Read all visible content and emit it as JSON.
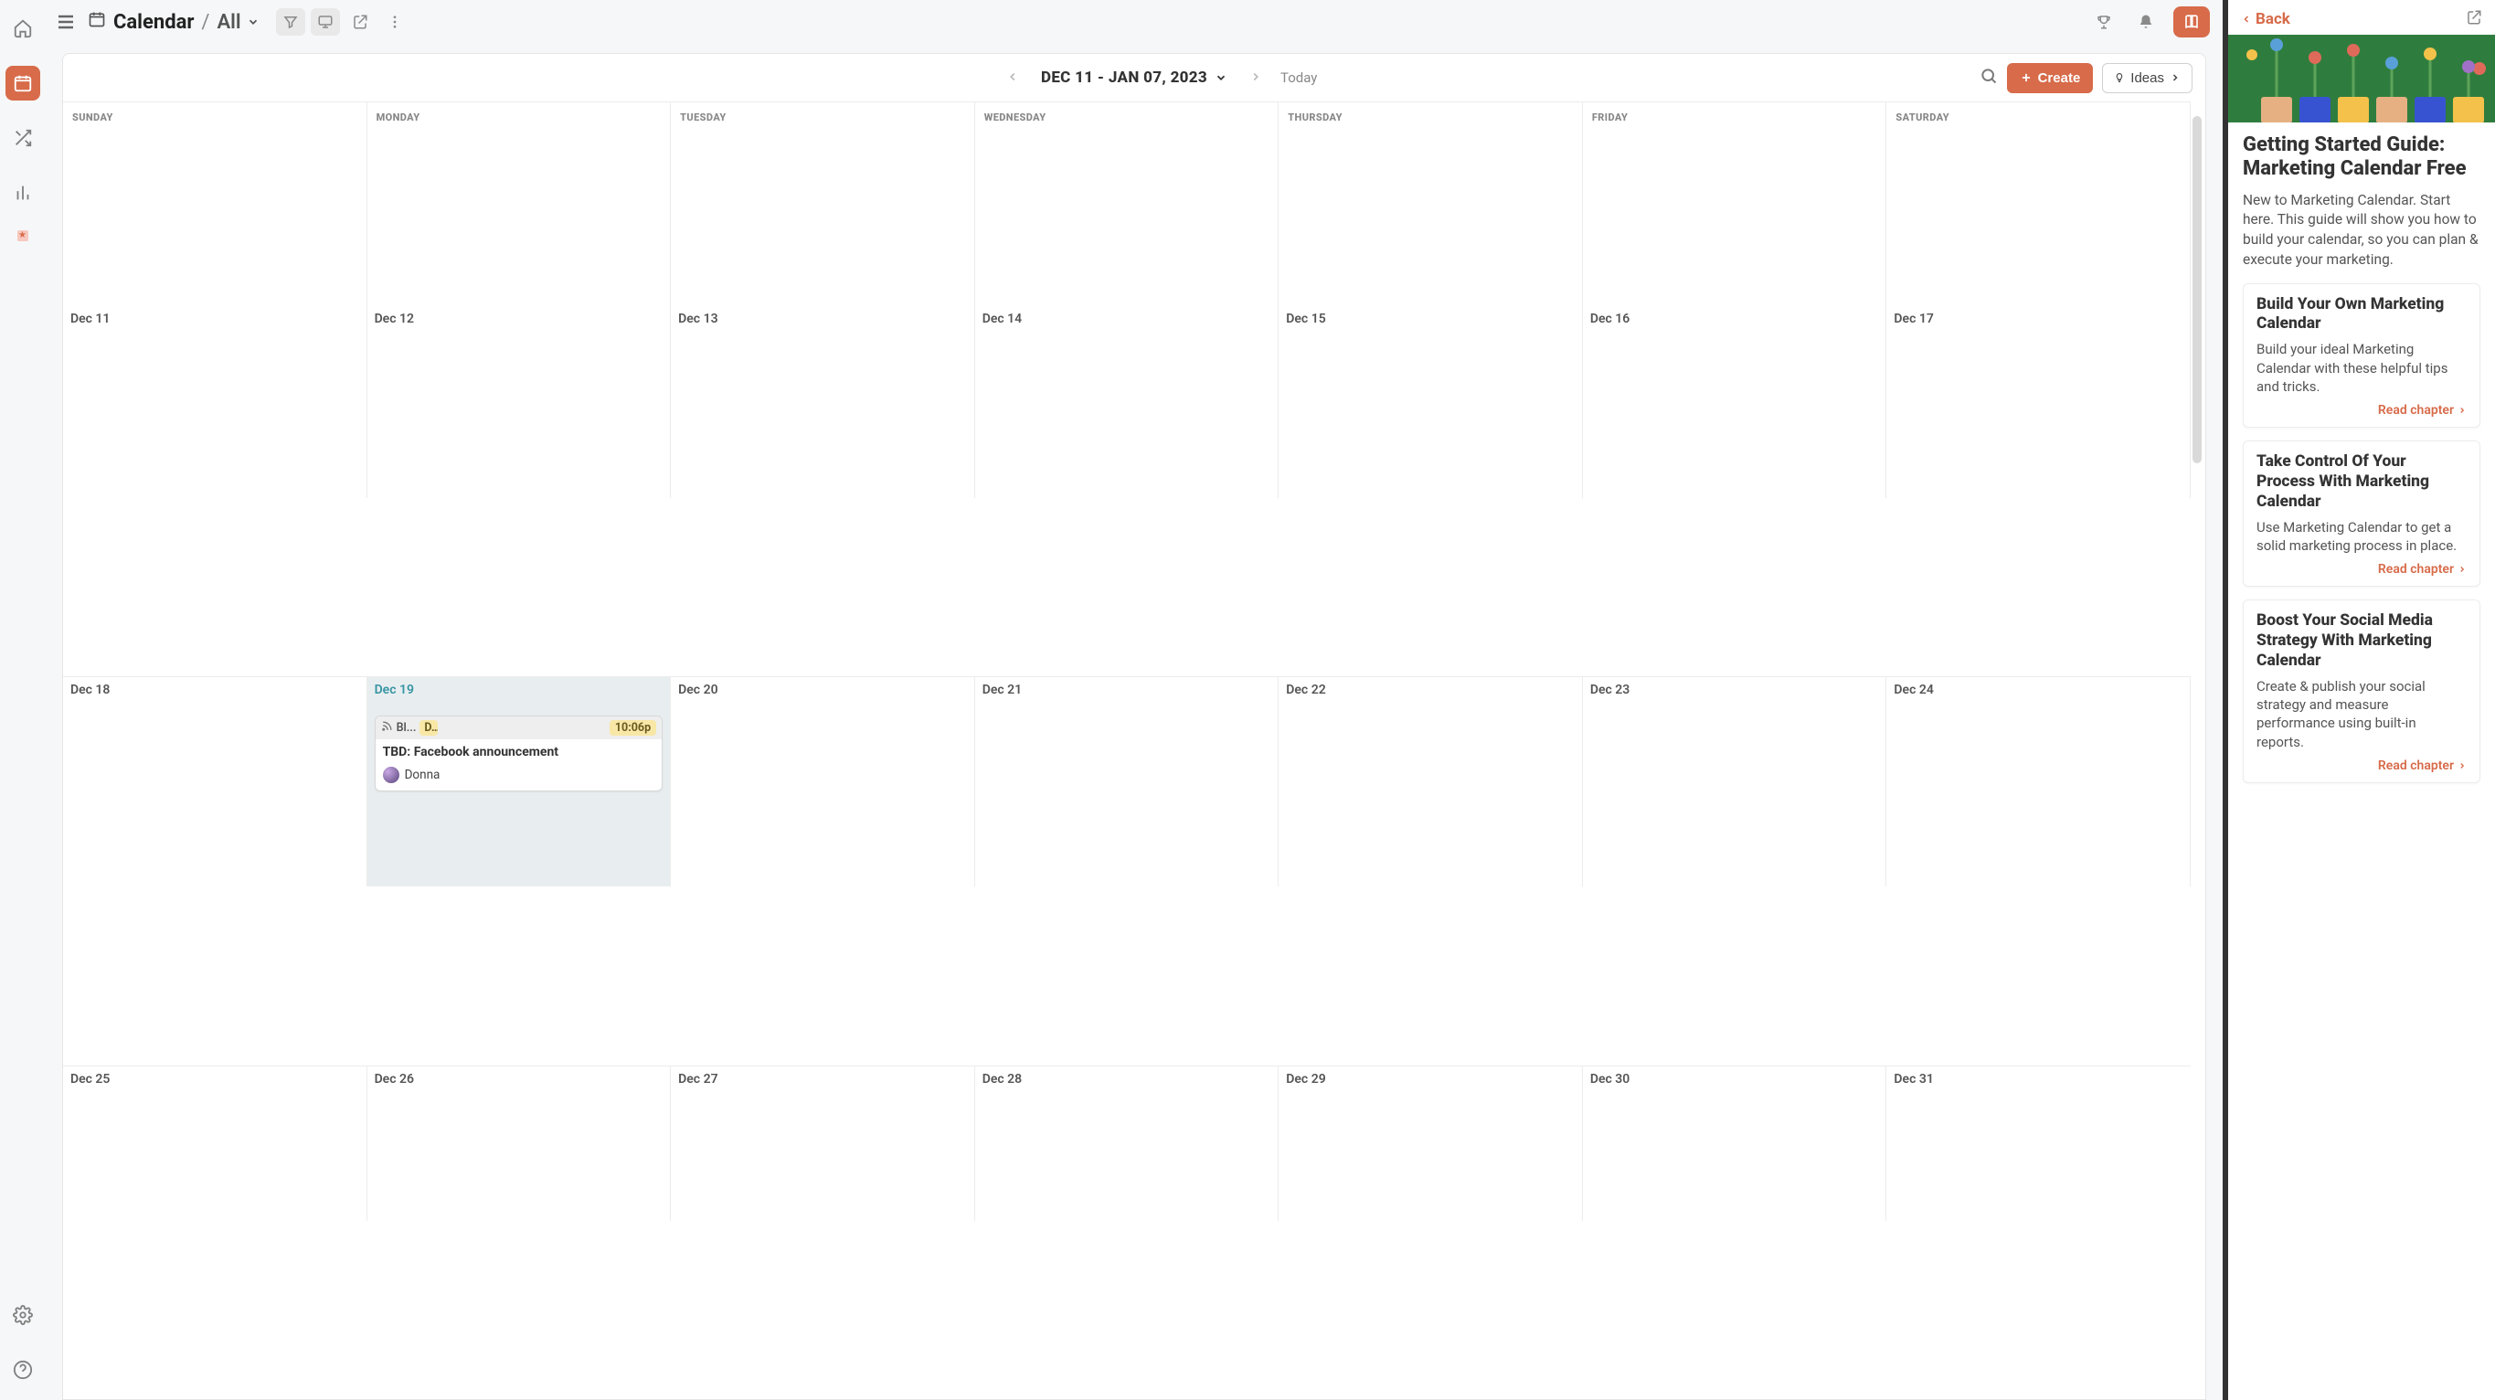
{
  "header": {
    "title": "Calendar",
    "view": "All"
  },
  "calendar": {
    "range_label": "DEC 11 - JAN 07, 2023",
    "today_label": "Today",
    "create_label": "Create",
    "ideas_label": "Ideas",
    "dow": [
      "SUNDAY",
      "MONDAY",
      "TUESDAY",
      "WEDNESDAY",
      "THURSDAY",
      "FRIDAY",
      "SATURDAY"
    ],
    "weeks": [
      [
        "Dec 11",
        "Dec 12",
        "Dec 13",
        "Dec 14",
        "Dec 15",
        "Dec 16",
        "Dec 17"
      ],
      [
        "Dec 18",
        "Dec 19",
        "Dec 20",
        "Dec 21",
        "Dec 22",
        "Dec 23",
        "Dec 24"
      ],
      [
        "Dec 25",
        "Dec 26",
        "Dec 27",
        "Dec 28",
        "Dec 29",
        "Dec 30",
        "Dec 31"
      ]
    ],
    "today_index": {
      "week": 1,
      "day": 1
    }
  },
  "event": {
    "tag_short": "Bl...",
    "status_short": "D...",
    "time": "10:06p",
    "title": "TBD: Facebook announcement",
    "assignee": "Donna"
  },
  "guide": {
    "back_label": "Back",
    "title": "Getting Started Guide: Marketing Calendar Free",
    "lead": "New to Marketing Calendar. Start here. This guide will show you how to build your calendar, so you can plan & execute your marketing.",
    "read_label": "Read chapter",
    "chapters": [
      {
        "title": "Build Your Own Marketing Calendar",
        "desc": "Build your ideal Marketing Calendar with these helpful tips and tricks."
      },
      {
        "title": "Take Control Of Your Process With Marketing Calendar",
        "desc": "Use Marketing Calendar to get a solid marketing process in place."
      },
      {
        "title": "Boost Your Social Media Strategy With Marketing Calendar",
        "desc": "Create & publish your social strategy and measure performance using built-in reports."
      }
    ]
  }
}
